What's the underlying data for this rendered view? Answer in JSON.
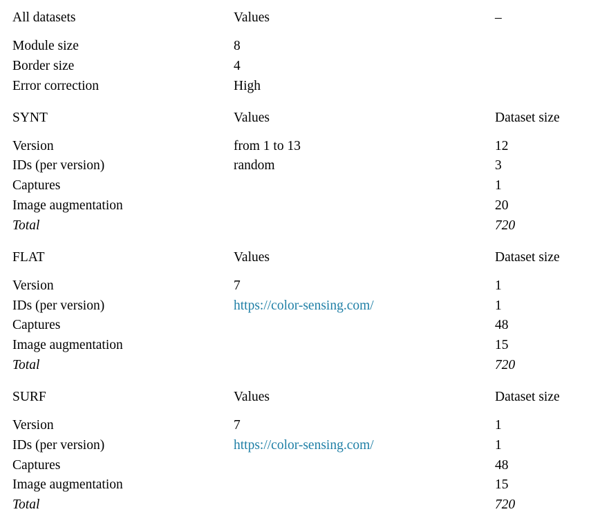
{
  "document": {
    "type": "academic-table",
    "caption_partial": "figure/table caption text clipped at top edge",
    "link_color": "#1f7fa6",
    "rule_color": "#111111",
    "background": "#ffffff"
  },
  "columns": {
    "label": "",
    "values": "Values",
    "dataset_size": "Dataset size"
  },
  "sections": [
    {
      "id": "all-datasets",
      "header": {
        "name": "All datasets",
        "values": "Values",
        "size": "–"
      },
      "rows": [
        {
          "label": "Module size",
          "value": "8",
          "size": ""
        },
        {
          "label": "Border size",
          "value": "4",
          "size": ""
        },
        {
          "label": "Error correction",
          "value": "High",
          "size": ""
        }
      ]
    },
    {
      "id": "synt",
      "header": {
        "name": "SYNT",
        "values": "Values",
        "size": "Dataset size"
      },
      "rows": [
        {
          "label": "Version",
          "value": "from 1 to 13",
          "size": "12"
        },
        {
          "label": "IDs (per version)",
          "value": "random",
          "size": "3"
        },
        {
          "label": "Captures",
          "value": "",
          "size": "1"
        },
        {
          "label": "Image augmentation",
          "value": "",
          "size": "20"
        },
        {
          "label": "Total",
          "value": "",
          "size": "720",
          "italic": true
        }
      ]
    },
    {
      "id": "flat",
      "header": {
        "name": "FLAT",
        "values": "Values",
        "size": "Dataset size"
      },
      "rows": [
        {
          "label": "Version",
          "value": "7",
          "size": "1"
        },
        {
          "label": "IDs (per version)",
          "value": "https://color-sensing.com/",
          "link": true,
          "size": "1"
        },
        {
          "label": "Captures",
          "value": "",
          "size": "48"
        },
        {
          "label": "Image augmentation",
          "value": "",
          "size": "15"
        },
        {
          "label": "Total",
          "value": "",
          "size": "720",
          "italic": true
        }
      ]
    },
    {
      "id": "surf",
      "header": {
        "name": "SURF",
        "values": "Values",
        "size": "Dataset size"
      },
      "rows": [
        {
          "label": "Version",
          "value": "7",
          "size": "1"
        },
        {
          "label": "IDs (per version)",
          "value": "https://color-sensing.com/",
          "link": true,
          "size": "1"
        },
        {
          "label": "Captures",
          "value": "",
          "size": "48"
        },
        {
          "label": "Image augmentation",
          "value": "",
          "size": "15"
        },
        {
          "label": "Total",
          "value": "",
          "size": "720",
          "italic": true
        }
      ]
    }
  ]
}
